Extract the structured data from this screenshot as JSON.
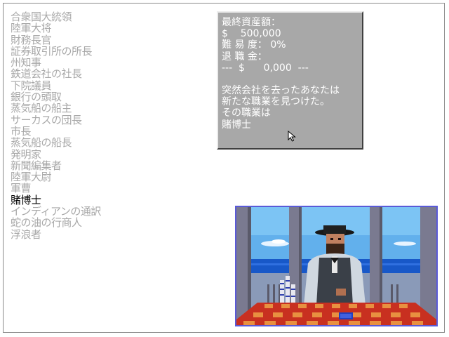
{
  "careers": [
    {
      "label": "合衆国大統領",
      "selected": false
    },
    {
      "label": "陸軍大将",
      "selected": false
    },
    {
      "label": "財務長官",
      "selected": false
    },
    {
      "label": "証券取引所の所長",
      "selected": false
    },
    {
      "label": "州知事",
      "selected": false
    },
    {
      "label": "鉄道会社の社長",
      "selected": false
    },
    {
      "label": "下院議員",
      "selected": false
    },
    {
      "label": "銀行の頭取",
      "selected": false
    },
    {
      "label": "蒸気船の船主",
      "selected": false
    },
    {
      "label": "サーカスの団長",
      "selected": false
    },
    {
      "label": "市長",
      "selected": false
    },
    {
      "label": "蒸気船の船長",
      "selected": false
    },
    {
      "label": "発明家",
      "selected": false
    },
    {
      "label": "新聞編集者",
      "selected": false
    },
    {
      "label": "陸軍大尉",
      "selected": false
    },
    {
      "label": "軍曹",
      "selected": false
    },
    {
      "label": "賭博士",
      "selected": true
    },
    {
      "label": "インディアンの通訳",
      "selected": false
    },
    {
      "label": "蛇の油の行商人",
      "selected": false
    },
    {
      "label": "浮浪者",
      "selected": false
    }
  ],
  "info": {
    "assets_label": "最終資産額：",
    "assets_value": "$    500,000",
    "difficulty": "難 易 度： 0%",
    "retirement_label": "退 職 金：",
    "retirement_value": "---  $      0,000  ---",
    "message": [
      "突然会社を去ったあなたは",
      "新たな職業を見つけた。",
      "その職業は",
      "賭博士"
    ]
  },
  "colors": {
    "background": "#ffffff",
    "list_inactive": "#a8a8a8",
    "list_selected": "#000000",
    "panel": "#a8a8a8",
    "panel_text": "#ffffff",
    "scene_border": "#5a5ad8"
  },
  "icons": {
    "cursor": "arrow-pointer-icon"
  }
}
